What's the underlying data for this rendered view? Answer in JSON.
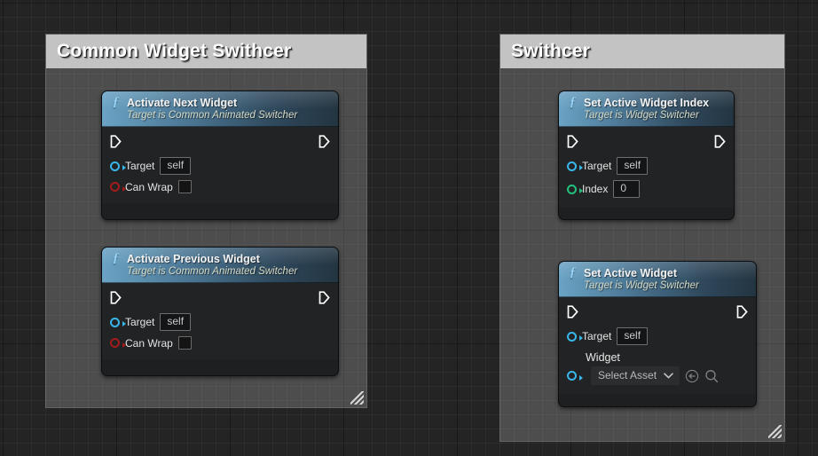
{
  "editor": {
    "name": "blueprint-graph-editor",
    "background": "#242424",
    "grid_minor_color": "#2e2e2e",
    "grid_major_color": "#0d0d0d"
  },
  "comments": [
    {
      "title": "Common Widget Swithcer",
      "title_bar_color": "#c3c3c3",
      "body_color": "#acacac"
    },
    {
      "title": "Swithcer",
      "title_bar_color": "#c3c3c3",
      "body_color": "#acacac"
    }
  ],
  "nodes": [
    {
      "id": "activate-next-widget",
      "icon": "function-f-icon",
      "title": "Activate Next Widget",
      "subtitle": "Target is Common Animated Switcher",
      "exec_in": "exec-in-pin",
      "exec_out": "exec-out-pin",
      "pins": [
        {
          "label": "Target",
          "value": "self",
          "control": "value-box",
          "color": "#39b7ea"
        },
        {
          "label": "Can Wrap",
          "value": "",
          "control": "checkbox",
          "color": "#a31c1c"
        }
      ]
    },
    {
      "id": "activate-previous-widget",
      "icon": "function-f-icon",
      "title": "Activate Previous Widget",
      "subtitle": "Target is Common Animated Switcher",
      "exec_in": "exec-in-pin",
      "exec_out": "exec-out-pin",
      "pins": [
        {
          "label": "Target",
          "value": "self",
          "control": "value-box",
          "color": "#39b7ea"
        },
        {
          "label": "Can Wrap",
          "value": "",
          "control": "checkbox",
          "color": "#a31c1c"
        }
      ]
    },
    {
      "id": "set-active-widget-index",
      "icon": "function-f-icon",
      "title": "Set Active Widget Index",
      "subtitle": "Target is Widget Switcher",
      "exec_in": "exec-in-pin",
      "exec_out": "exec-out-pin",
      "pins": [
        {
          "label": "Target",
          "value": "self",
          "control": "value-box",
          "color": "#39b7ea"
        },
        {
          "label": "Index",
          "value": "0",
          "control": "value-box",
          "color": "#22c17f"
        }
      ]
    },
    {
      "id": "set-active-widget",
      "icon": "function-f-icon",
      "title": "Set Active Widget",
      "subtitle": "Target is Widget Switcher",
      "exec_in": "exec-in-pin",
      "exec_out": "exec-out-pin",
      "pins": [
        {
          "label": "Target",
          "value": "self",
          "control": "value-box",
          "color": "#39b7ea"
        }
      ],
      "asset_pin": {
        "label": "Widget",
        "selected": "Select Asset",
        "dropdown_icon": "chevron-down-icon",
        "browse_icon": "browse-to-asset-icon",
        "search_icon": "search-icon",
        "color": "#39b7ea"
      }
    }
  ]
}
